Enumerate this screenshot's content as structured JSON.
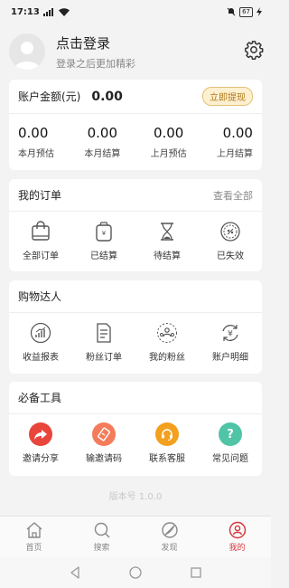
{
  "status_bar": {
    "time": "17:13",
    "battery": "67"
  },
  "profile": {
    "title": "点击登录",
    "subtitle": "登录之后更加精彩"
  },
  "balance": {
    "label": "账户金额(元)",
    "amount": "0.00",
    "withdraw_label": "立即提现",
    "stats": [
      {
        "value": "0.00",
        "label": "本月预估"
      },
      {
        "value": "0.00",
        "label": "本月结算"
      },
      {
        "value": "0.00",
        "label": "上月预估"
      },
      {
        "value": "0.00",
        "label": "上月结算"
      }
    ]
  },
  "orders": {
    "title": "我的订单",
    "view_all": "查看全部",
    "items": [
      {
        "label": "全部订单",
        "icon": "bag-icon"
      },
      {
        "label": "已结算",
        "icon": "wallet-icon"
      },
      {
        "label": "待结算",
        "icon": "hourglass-icon"
      },
      {
        "label": "已失效",
        "icon": "expired-icon"
      }
    ]
  },
  "shopping_expert": {
    "title": "购物达人",
    "items": [
      {
        "label": "收益报表",
        "icon": "chart-icon"
      },
      {
        "label": "粉丝订单",
        "icon": "document-icon"
      },
      {
        "label": "我的粉丝",
        "icon": "fans-icon"
      },
      {
        "label": "账户明细",
        "icon": "yen-refresh-icon"
      }
    ]
  },
  "tools": {
    "title": "必备工具",
    "items": [
      {
        "label": "邀请分享",
        "icon": "share-icon",
        "color": "#e8453c"
      },
      {
        "label": "输邀请码",
        "icon": "ticket-icon",
        "color": "#f47c5a"
      },
      {
        "label": "联系客服",
        "icon": "headset-icon",
        "color": "#f3a01e"
      },
      {
        "label": "常见问题",
        "icon": "question-icon",
        "color": "#4fc4a6"
      }
    ]
  },
  "version": "版本号 1.0.0",
  "tabs": [
    {
      "label": "首页",
      "icon": "home-icon"
    },
    {
      "label": "搜索",
      "icon": "search-icon"
    },
    {
      "label": "发现",
      "icon": "discover-icon"
    },
    {
      "label": "我的",
      "icon": "user-icon",
      "active": true
    }
  ],
  "accent_color": "#d6383d"
}
